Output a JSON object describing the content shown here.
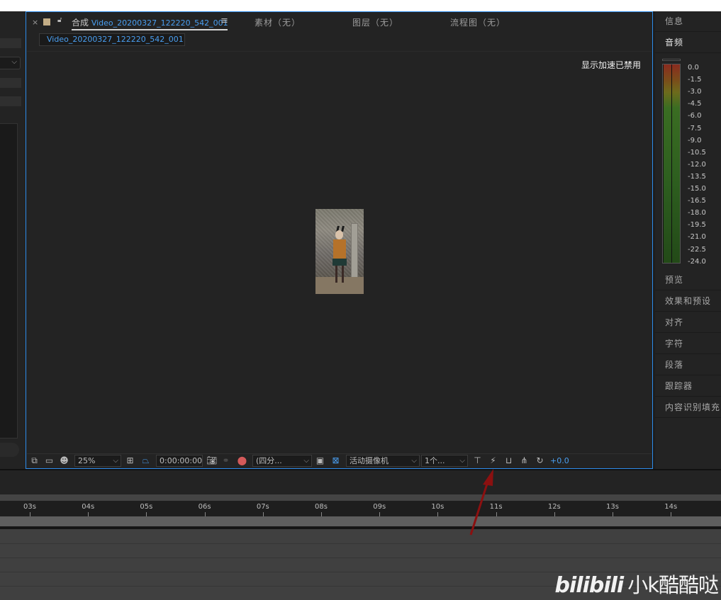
{
  "composition": {
    "tab_prefix": "合成",
    "tab_name": "Video_20200327_122220_542_001",
    "subtab": "Video_20200327_122220_542_001",
    "other_tabs": [
      "素材（无）",
      "图层（无）",
      "流程图（无）"
    ],
    "viewer_notice": "显示加速已禁用"
  },
  "toolbar": {
    "zoom": "25%",
    "timecode": "0:00:00:00",
    "resolution": "(四分...",
    "camera": "活动摄像机",
    "views": "1个...",
    "exposure": "+0.0"
  },
  "right_panels": {
    "info": "信息",
    "audio": "音频",
    "preview": "预览",
    "effects": "效果和预设",
    "align": "对齐",
    "character": "字符",
    "paragraph": "段落",
    "tracker": "跟踪器",
    "content_aware": "内容识别填充"
  },
  "audio_scale": [
    "0.0",
    "-1.5",
    "-3.0",
    "-4.5",
    "-6.0",
    "-7.5",
    "-9.0",
    "-10.5",
    "-12.0",
    "-13.5",
    "-15.0",
    "-16.5",
    "-18.0",
    "-19.5",
    "-21.0",
    "-22.5",
    "-24.0"
  ],
  "timeline": {
    "ticks": [
      "03s",
      "04s",
      "05s",
      "06s",
      "07s",
      "08s",
      "09s",
      "10s",
      "11s",
      "12s",
      "13s",
      "14s"
    ]
  },
  "watermark": {
    "logo": "bilibili",
    "handle": "小k酷酷哒"
  },
  "colors": {
    "accent_blue": "#2d8ceb",
    "label_swatch": "#c3ad86",
    "annotation_arrow": "#8b1010"
  }
}
